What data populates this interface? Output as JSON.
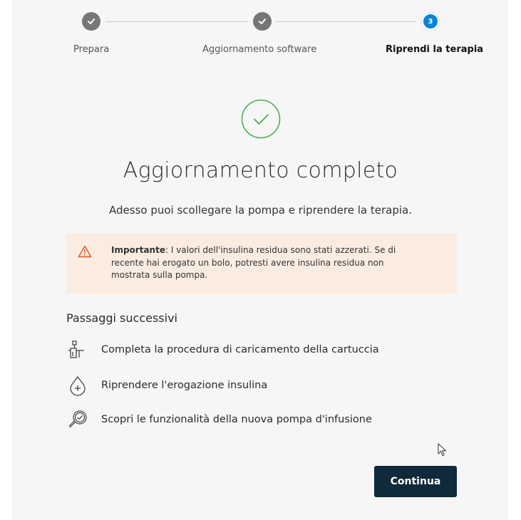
{
  "stepper": {
    "steps": [
      {
        "label": "Prepara",
        "state": "done"
      },
      {
        "label": "Aggiornamento software",
        "state": "done"
      },
      {
        "label": "Riprendi la terapia",
        "state": "active",
        "number": "3"
      }
    ]
  },
  "main": {
    "title": "Aggiornamento completo",
    "subtitle": "Adesso puoi scollegare la pompa e riprendere la terapia."
  },
  "alert": {
    "strong": "Importante",
    "text": ": I valori dell'insulina residua sono stati azzerati. Se di recente hai erogato un bolo, potresti avere insulina residua non mostrata sulla pompa."
  },
  "next_steps": {
    "title": "Passaggi successivi",
    "items": [
      {
        "label": "Completa la procedura di caricamento della cartuccia",
        "icon": "cartridge-icon"
      },
      {
        "label": "Riprendere l'erogazione insulina",
        "icon": "drop-plus-icon"
      },
      {
        "label": "Scopri le funzionalità della nuova pompa d'infusione",
        "icon": "magnifier-check-icon"
      }
    ]
  },
  "actions": {
    "continue_label": "Continua"
  },
  "colors": {
    "primary_button": "#0e2a3b",
    "active_step": "#0a84d6",
    "success_green": "#4caf50",
    "alert_bg": "#fbece1",
    "alert_icon": "#d9541e"
  }
}
